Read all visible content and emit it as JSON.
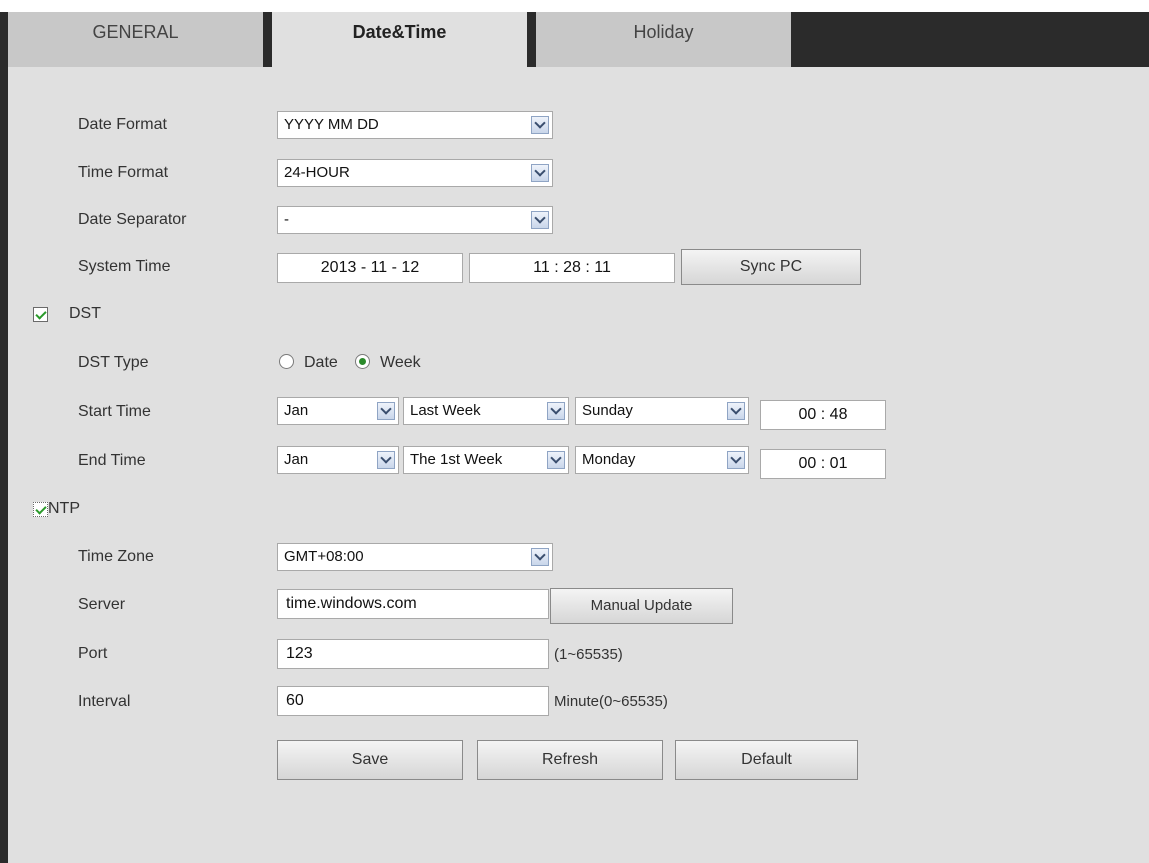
{
  "tabs": [
    {
      "label": "GENERAL",
      "active": false
    },
    {
      "label": "Date&Time",
      "active": true
    },
    {
      "label": "Holiday",
      "active": false
    }
  ],
  "date_format": {
    "label": "Date Format",
    "value": "YYYY MM DD"
  },
  "time_format": {
    "label": "Time Format",
    "value": "24-HOUR"
  },
  "date_separator": {
    "label": "Date Separator",
    "value": "-"
  },
  "system_time": {
    "label": "System Time",
    "date": "2013 - 11 - 12",
    "time": "11 : 28 : 11",
    "sync_button": "Sync PC"
  },
  "dst": {
    "label": "DST",
    "checked": true,
    "type_label": "DST Type",
    "type_options": [
      "Date",
      "Week"
    ],
    "type_selected": "Week",
    "start": {
      "label": "Start Time",
      "month": "Jan",
      "week": "Last Week",
      "day": "Sunday",
      "time": "00 : 48"
    },
    "end": {
      "label": "End Time",
      "month": "Jan",
      "week": "The 1st Week",
      "day": "Monday",
      "time": "00 : 01"
    }
  },
  "ntp": {
    "label": "NTP",
    "checked": true,
    "timezone_label": "Time Zone",
    "timezone_value": "GMT+08:00",
    "server_label": "Server",
    "server_value": "time.windows.com",
    "manual_update_button": "Manual Update",
    "port_label": "Port",
    "port_value": "123",
    "port_range": "(1~65535)",
    "interval_label": "Interval",
    "interval_value": "60",
    "interval_unit": "Minute(0~65535)"
  },
  "actions": {
    "save": "Save",
    "refresh": "Refresh",
    "default": "Default"
  },
  "colors": {
    "panel": "#e0e0e0",
    "frame": "#2b2b2b",
    "check_green": "#2a9a2a"
  }
}
